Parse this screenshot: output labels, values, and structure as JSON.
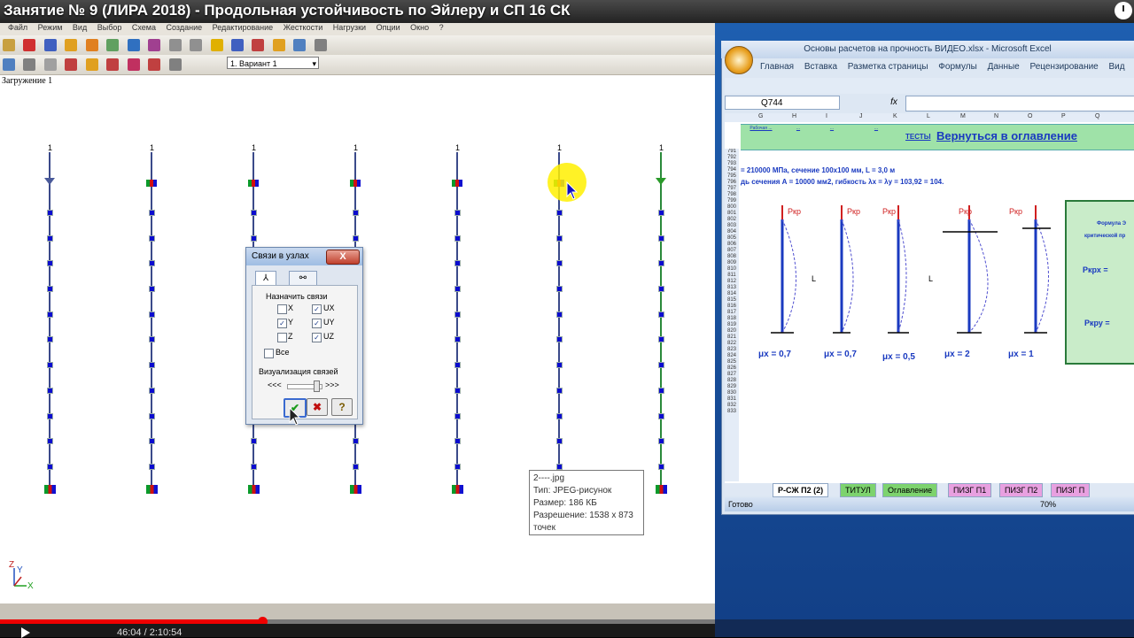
{
  "video": {
    "title": "Занятие № 9 (ЛИРА 2018) - Продольная устойчивость по Эйлеру и СП 16 СК",
    "time": "46:04 / 2:10:54",
    "progress": 0.367
  },
  "lira": {
    "menu": [
      "Файл",
      "Режим",
      "Вид",
      "Выбор",
      "Схема",
      "Создание",
      "Редактирование",
      "Жесткости",
      "Нагрузки",
      "Опции",
      "Окно",
      "?"
    ],
    "variant": "1. Вариант 1",
    "loading_label": "Загружение 1",
    "column_number": "1",
    "axes": {
      "z": "Z",
      "y": "Y",
      "x": "X"
    }
  },
  "dialog": {
    "title": "Связи в узлах",
    "close": "X",
    "section_title": "Назначить связи",
    "checkboxes": [
      {
        "label": "X",
        "checked": false
      },
      {
        "label": "UX",
        "checked": true
      },
      {
        "label": "Y",
        "checked": true
      },
      {
        "label": "UY",
        "checked": true
      },
      {
        "label": "Z",
        "checked": false
      },
      {
        "label": "UZ",
        "checked": true
      }
    ],
    "all_label": "Все",
    "visual_label": "Визуализация связей",
    "slider_left": "<<<",
    "slider_right": ">>>",
    "btn_ok": "✔",
    "btn_cancel": "✖",
    "btn_help": "?"
  },
  "tooltip": {
    "name": "2----.jpg",
    "type": "Тип: JPEG-рисунок",
    "size": "Размер: 186 КБ",
    "resolution": "Разрешение: 1538 x 873",
    "units": "точек"
  },
  "excel": {
    "title": "Основы расчетов на прочность ВИДЕО.xlsx - Microsoft Excel",
    "tabs": [
      "Главная",
      "Вставка",
      "Разметка страницы",
      "Формулы",
      "Данные",
      "Рецензирование",
      "Вид"
    ],
    "namebox": "Q744",
    "fx": "fx",
    "columns": [
      "G",
      "H",
      "I",
      "J",
      "K",
      "L",
      "M",
      "N",
      "O",
      "P",
      "Q"
    ],
    "rows": [
      "1",
      "791",
      "792",
      "793",
      "794",
      "795",
      "796",
      "797",
      "798",
      "799",
      "800",
      "801",
      "802",
      "803",
      "804",
      "805",
      "806",
      "807",
      "808",
      "809",
      "810",
      "811",
      "812",
      "813",
      "814",
      "815",
      "816",
      "817",
      "818",
      "819",
      "820",
      "821",
      "822",
      "823",
      "824",
      "825",
      "826",
      "827",
      "828",
      "829",
      "830",
      "831",
      "832",
      "833"
    ],
    "header_links": [
      "Рабочая ...",
      "...",
      "...",
      "...",
      "ТЕСТЫ"
    ],
    "back_link": "Вернуться в оглавление",
    "line1": "= 210000 МПа, сечение 100x100 мм, L = 3,0 м",
    "line2": "дь сечения А = 10000 мм2, гибкость λx = λy = 103,92 = 104.",
    "p_label": "Pкр",
    "l_label": "L",
    "mu": [
      "μx = 0,7",
      "μx = 0,7",
      "μx = 0,5",
      "μx = 2",
      "μx = 1"
    ],
    "formula_title1": "Формула Э",
    "formula_title2": "критической пр",
    "pkrx": "Pкрх =",
    "pkry": "Pкру =",
    "sheet_tabs": [
      "Р-СЖ П2 (2)",
      "ТИТУЛ",
      "Оглавление",
      "ПИЗГ П1",
      "ПИЗГ П2",
      "ПИЗГ П"
    ],
    "status": "Готово",
    "zoom": "70%"
  }
}
